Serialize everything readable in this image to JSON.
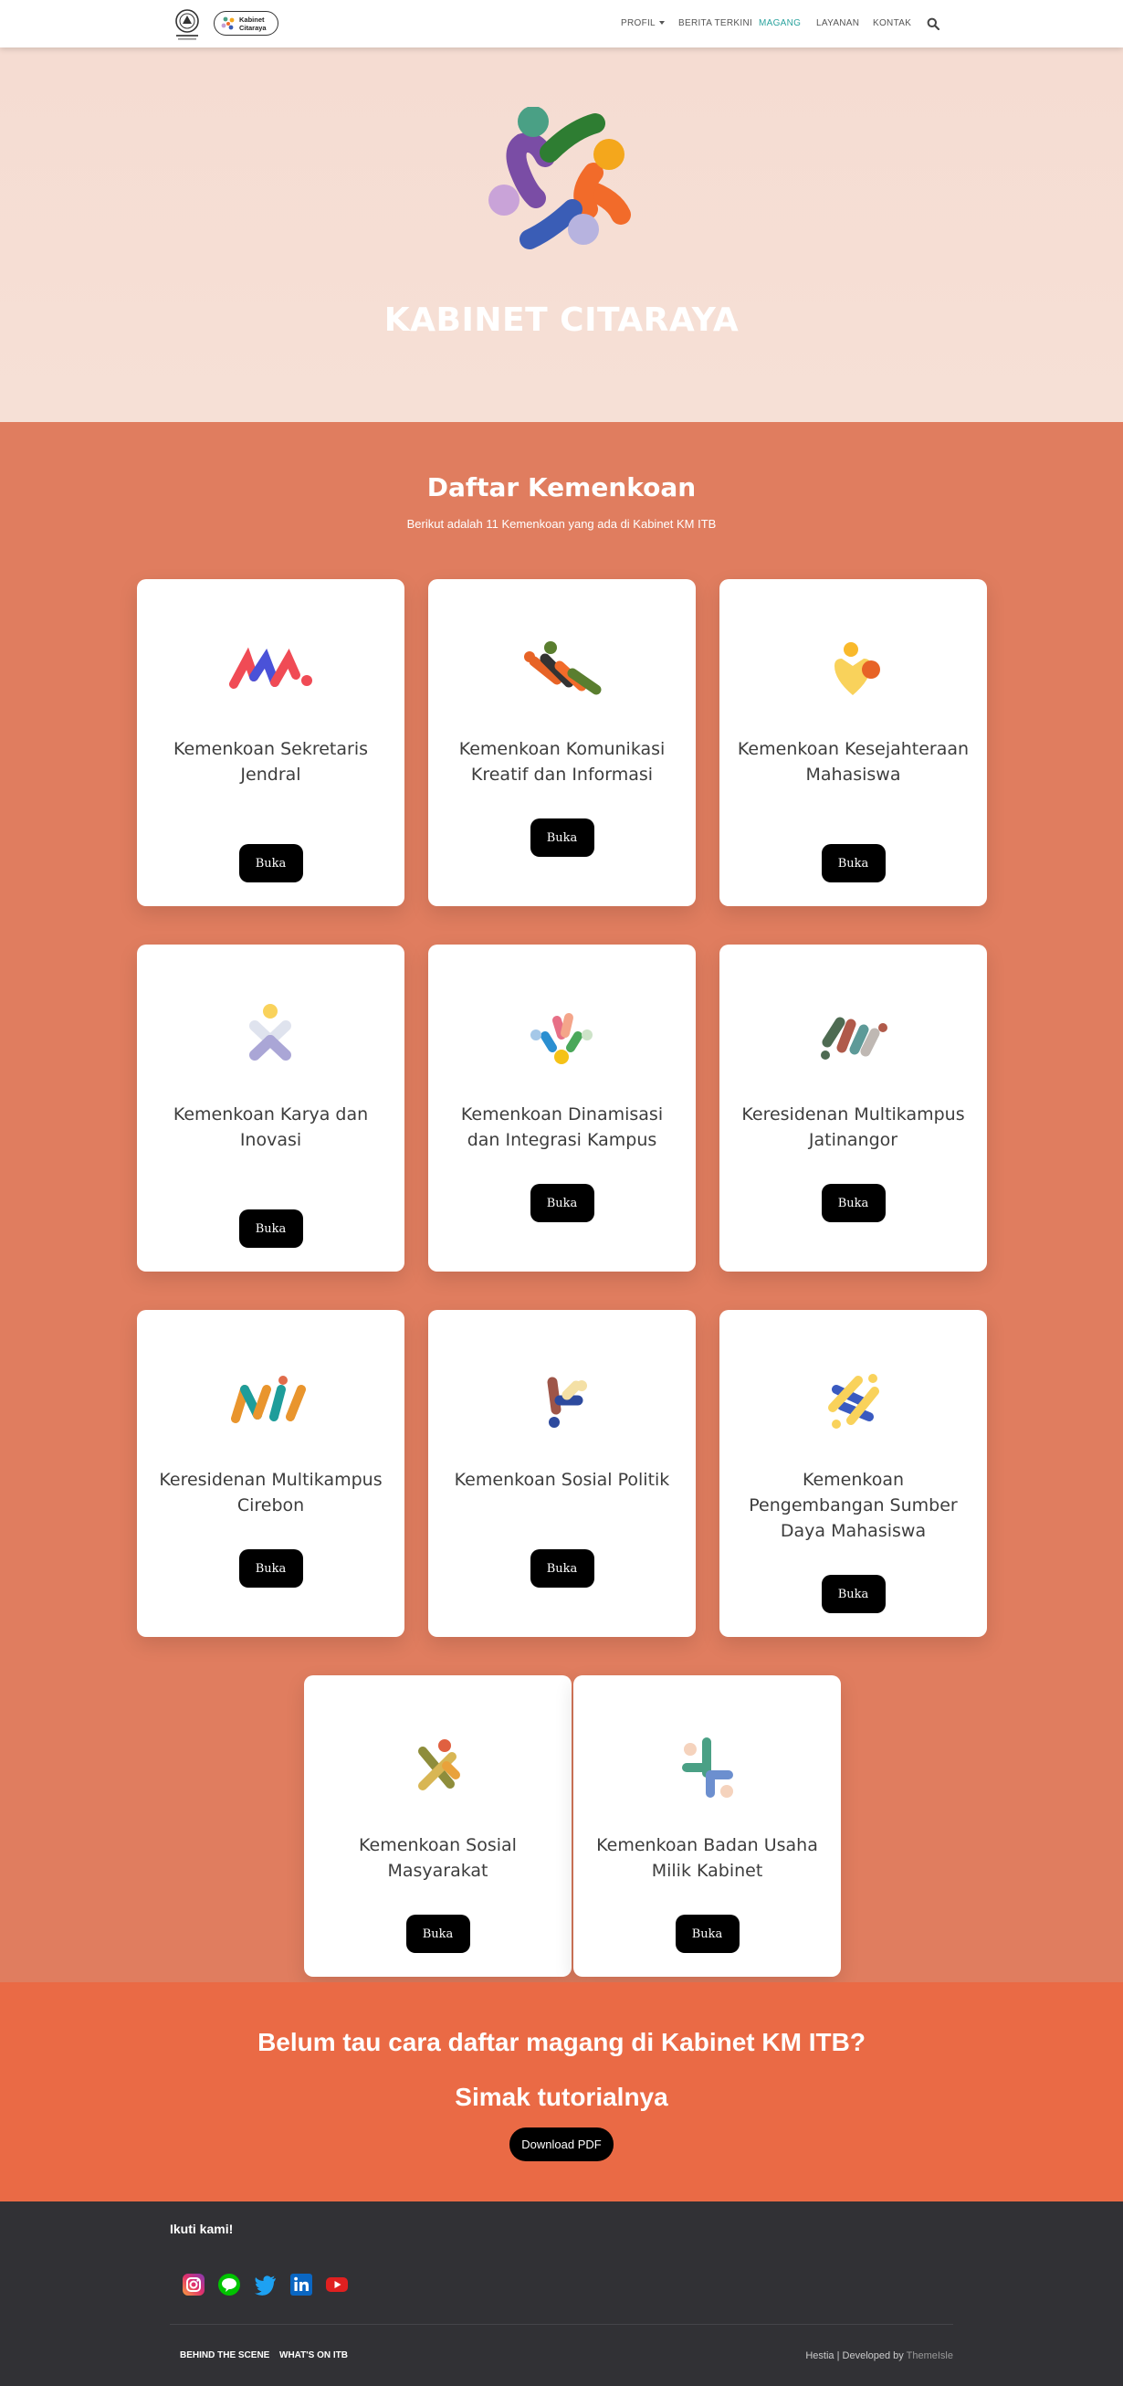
{
  "nav": {
    "logo_itb_alt": "Kabinet KM ITB",
    "logo_kabinet_line1": "Kabinet",
    "logo_kabinet_line2": "Citaraya",
    "links": [
      "PROFIL",
      "BERITA TERKINI",
      "MAGANG",
      "LAYANAN",
      "KONTAK"
    ],
    "active": "MAGANG",
    "accent_color": "#2ba39e"
  },
  "hero": {
    "title": "KABINET CITARAYA"
  },
  "section": {
    "title": "Daftar Kemenkoan",
    "subtitle": "Berikut adalah 11 Kemenkoan yang ada di Kabinet KM ITB",
    "button_label": "Buka",
    "cards": [
      {
        "title": "Kemenkoan Sekretaris Jendral",
        "icon": "sekjen-logo-icon"
      },
      {
        "title": "Kemenkoan Komunikasi Kreatif dan Informasi",
        "icon": "kominfo-logo-icon"
      },
      {
        "title": "Kemenkoan Kesejahteraan Mahasiswa",
        "icon": "kesma-logo-icon"
      },
      {
        "title": "Kemenkoan Karya dan Inovasi",
        "icon": "karya-inovasi-logo-icon"
      },
      {
        "title": "Kemenkoan Dinamisasi dan Integrasi Kampus",
        "icon": "dinamisasi-logo-icon"
      },
      {
        "title": "Keresidenan Multikampus Jatinangor",
        "icon": "jatinangor-logo-icon"
      },
      {
        "title": "Keresidenan Multikampus Cirebon",
        "icon": "cirebon-logo-icon"
      },
      {
        "title": "Kemenkoan Sosial Politik",
        "icon": "sospol-logo-icon"
      },
      {
        "title": "Kemenkoan Pengembangan Sumber Daya Mahasiswa",
        "icon": "psdm-logo-icon"
      },
      {
        "title": "Kemenkoan Sosial Masyarakat",
        "icon": "sosmas-logo-icon"
      },
      {
        "title": "Kemenkoan Badan Usaha Milik Kabinet",
        "icon": "bumk-logo-icon"
      }
    ]
  },
  "cta": {
    "line1": "Belum tau cara daftar magang di Kabinet KM ITB?",
    "line2": "Simak tutorialnya",
    "button_label": "Download PDF"
  },
  "footer": {
    "follow_title": "Ikuti kami!",
    "social": [
      "instagram-icon",
      "line-icon",
      "twitter-icon",
      "linkedin-icon",
      "youtube-icon"
    ],
    "links": [
      "BEHIND THE SCENE",
      "WHAT'S ON ITB"
    ],
    "credit_prefix": "Hestia | Developed by ",
    "credit_link": "ThemeIsle"
  },
  "colors": {
    "hero_bg": "#f5dcd2",
    "section_bg": "#e07d5f",
    "cta_bg": "#ea6a45",
    "footer_bg": "#313135"
  }
}
